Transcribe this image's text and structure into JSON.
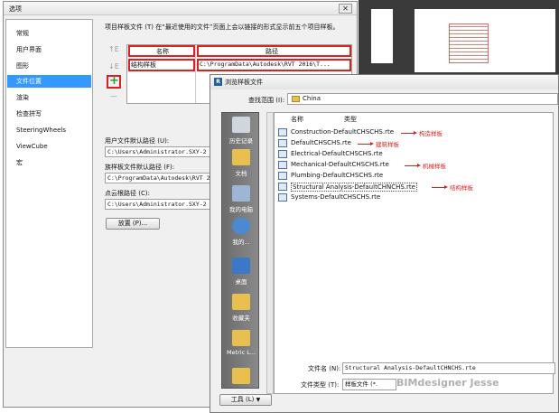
{
  "options_dialog": {
    "title": "选项",
    "close_glyph": "✕",
    "sidebar_items": [
      {
        "label": "常规"
      },
      {
        "label": "用户界面"
      },
      {
        "label": "图形"
      },
      {
        "label": "文件位置"
      },
      {
        "label": "渲染"
      },
      {
        "label": "检查拼写"
      },
      {
        "label": "SteeringWheels"
      },
      {
        "label": "ViewCube"
      },
      {
        "label": "宏"
      }
    ],
    "active_item": "文件位置",
    "description": "项目样板文件 (T) 在“最近使用的文件”页面上会以链接的形式显示前五个项目样板。",
    "move_up_glyph": "↑E",
    "move_down_glyph": "↓E",
    "add_glyph": "+",
    "remove_glyph": "—",
    "table": {
      "col_name": "名称",
      "col_path": "路径",
      "rows": [
        {
          "name": "结构样板",
          "path": "C:\\ProgramData\\Autodesk\\RVT 2016\\T..."
        }
      ]
    },
    "user_default_path_label": "用户文件默认路径 (U):",
    "user_default_path_value": "C:\\Users\\Administrator.SXY-2",
    "family_template_path_label": "族样板文件默认路径 (F):",
    "family_template_path_value": "C:\\ProgramData\\Autodesk\\RVT 2",
    "cloud_path_label": "点云根路径 (C):",
    "cloud_path_value": "C:\\Users\\Administrator.SXY-2",
    "places_button": "放置 (P)..."
  },
  "browse_dialog": {
    "title": "浏览样板文件",
    "lookin_label": "查找范围 (I):",
    "lookin_value": "China",
    "col_name": "名称",
    "col_type": "类型",
    "places": [
      {
        "label": "历史记录"
      },
      {
        "label": "文档"
      },
      {
        "label": "我的电脑"
      },
      {
        "label": "我的..."
      },
      {
        "label": "桌面"
      },
      {
        "label": "收藏夹"
      },
      {
        "label": "Metric L..."
      },
      {
        "label": ""
      }
    ],
    "files": [
      {
        "name": "Construction-DefaultCHSCHS.rte",
        "annotation": "构造样板"
      },
      {
        "name": "DefaultCHSCHS.rte",
        "annotation": "建筑样板"
      },
      {
        "name": "Electrical-DefaultCHSCHS.rte",
        "annotation": ""
      },
      {
        "name": "Mechanical-DefaultCHSCHS.rte",
        "annotation": "机械样板"
      },
      {
        "name": "Plumbing-DefaultCHSCHS.rte",
        "annotation": ""
      },
      {
        "name": "Structural Analysis-DefaultCHNCHS.rte",
        "annotation": "结构样板"
      },
      {
        "name": "Systems-DefaultCHSCHS.rte",
        "annotation": ""
      }
    ],
    "filename_label": "文件名 (N):",
    "filename_value": "Structural Analysis-DefaultCHNCHS.rte",
    "filetype_label": "文件类型 (T):",
    "filetype_value": "样板文件 (*.",
    "tools_button": "工具 (L)",
    "watermark": "BIMdesigner Jesse"
  },
  "colors": {
    "accent": "#3399ff",
    "annotation": "#e02020"
  }
}
